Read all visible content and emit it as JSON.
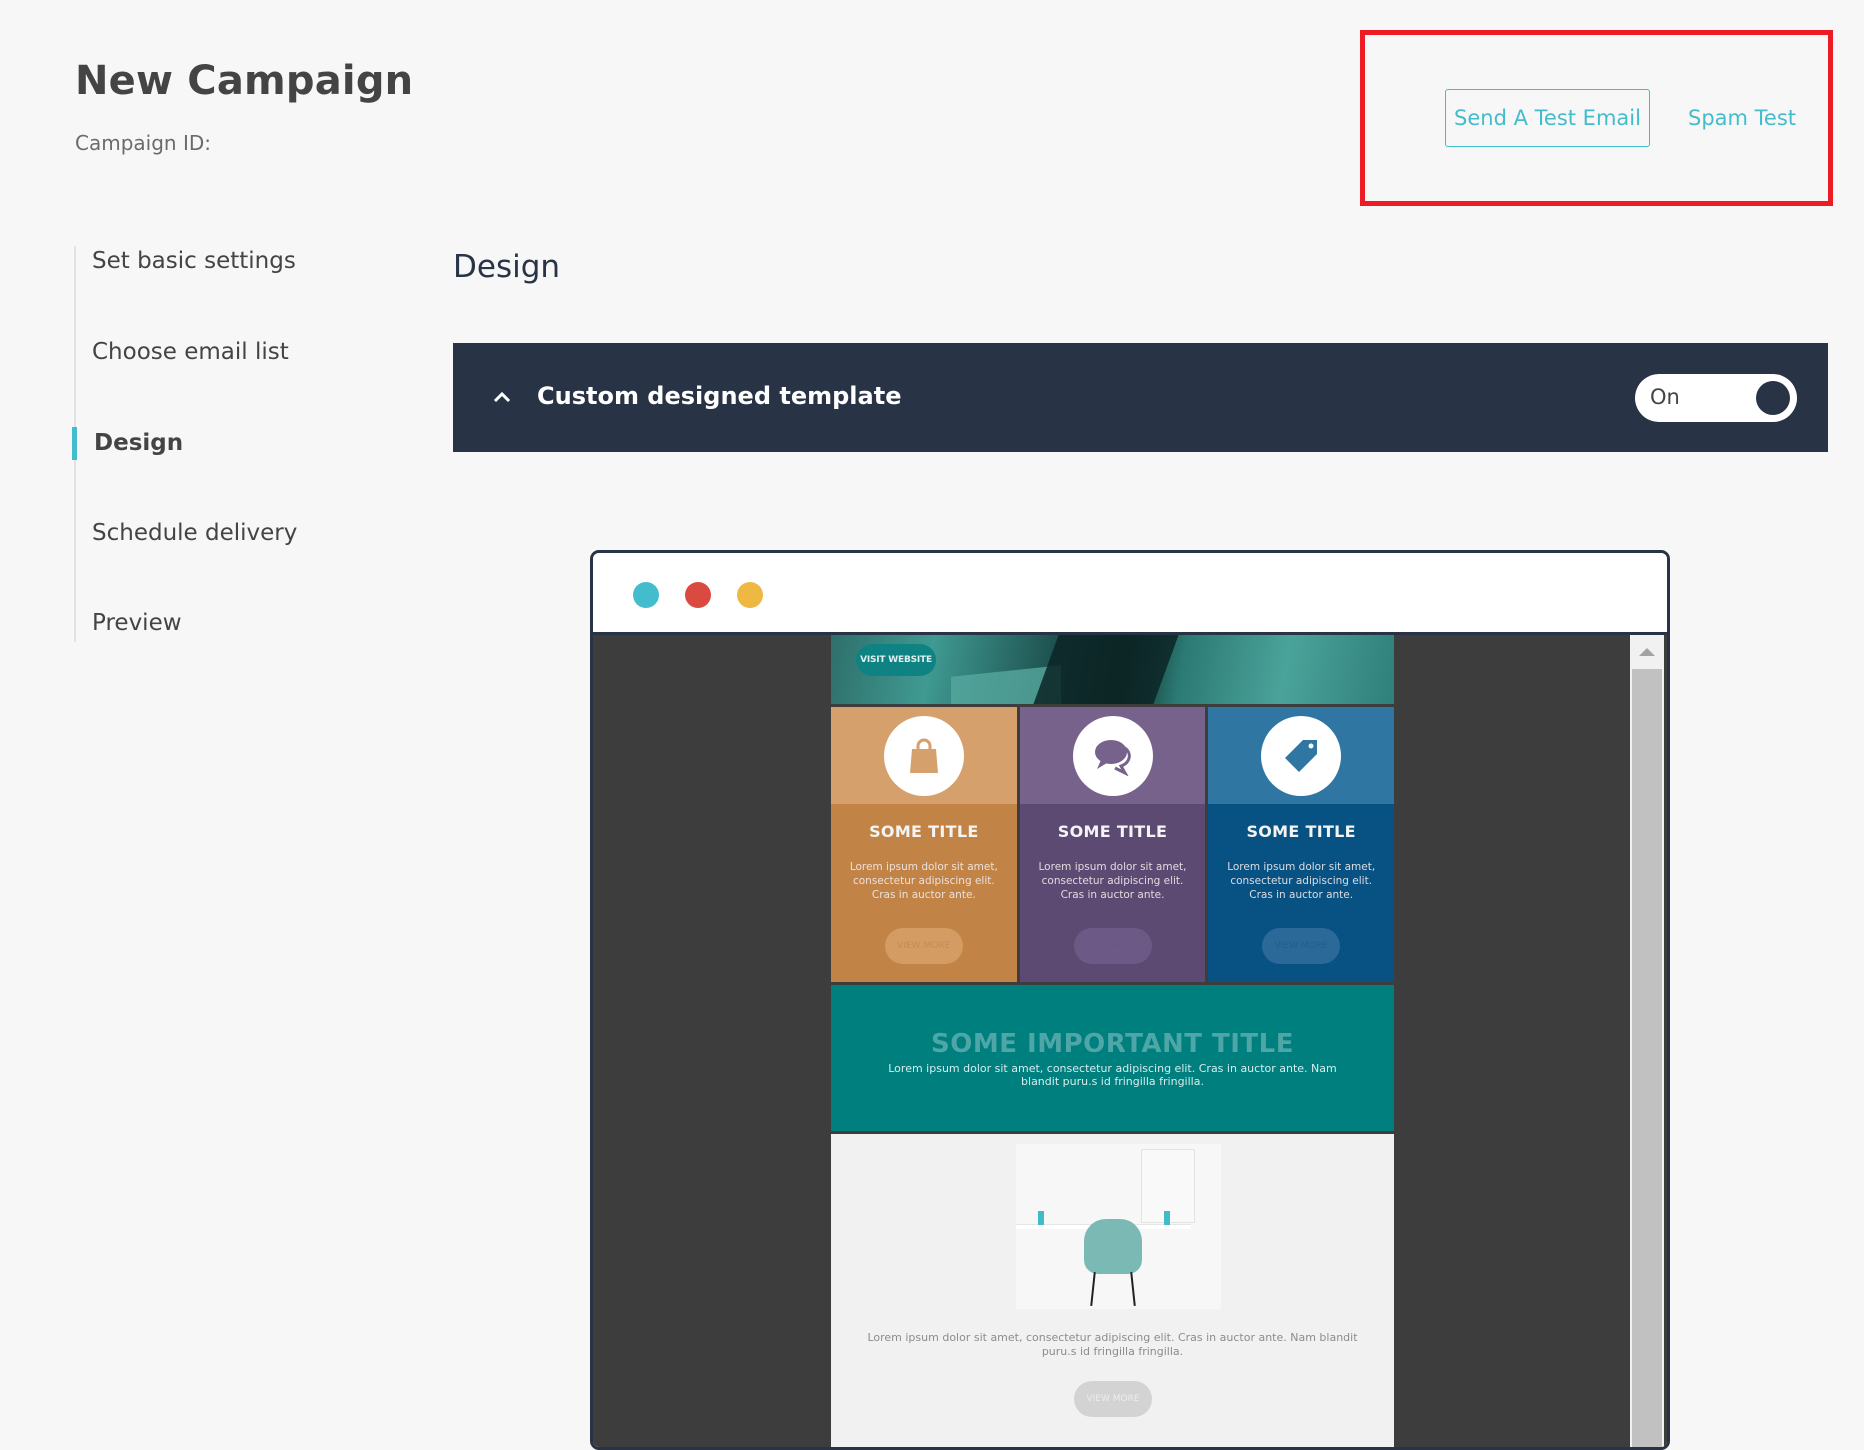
{
  "header": {
    "title": "New Campaign",
    "campaign_id_label": "Campaign ID:"
  },
  "actions": {
    "send_test_email": "Send A Test Email",
    "spam_test": "Spam Test"
  },
  "steps": [
    {
      "label": "Set basic settings",
      "active": false
    },
    {
      "label": "Choose email list",
      "active": false
    },
    {
      "label": "Design",
      "active": true
    },
    {
      "label": "Schedule delivery",
      "active": false
    },
    {
      "label": "Preview",
      "active": false
    }
  ],
  "main": {
    "section_title": "Design",
    "template_panel": {
      "label": "Custom designed template",
      "toggle_label": "On",
      "toggle_state": true,
      "chevron_icon": "chevron-up-icon"
    }
  },
  "preview": {
    "window_dots": [
      {
        "name": "teal",
        "color": "#43bccd"
      },
      {
        "name": "red",
        "color": "#da4a40"
      },
      {
        "name": "yellow",
        "color": "#eeb843"
      }
    ],
    "email": {
      "hero_button": "VISIT WEBSITE",
      "cards": [
        {
          "icon": "shopping-bag-icon",
          "title": "SOME TITLE",
          "text": "Lorem ipsum dolor sit amet, consectetur adipiscing elit. Cras in auctor ante.",
          "button": "VIEW MORE",
          "top_color": "#d5a06c",
          "bottom_color": "#c28446",
          "btn_color": "#d49c63",
          "btn_text_color": "#c58a52"
        },
        {
          "icon": "chat-bubbles-icon",
          "title": "SOME TITLE",
          "text": "Lorem ipsum dolor sit amet, consectetur adipiscing elit. Cras in auctor ante.",
          "button": "VIEW MORE",
          "top_color": "#77628b",
          "bottom_color": "#5c4a73",
          "btn_color": "#6d5985",
          "btn_text_color": "#6b5883"
        },
        {
          "icon": "price-tag-icon",
          "title": "SOME TITLE",
          "text": "Lorem ipsum dolor sit amet, consectetur adipiscing elit. Cras in auctor ante.",
          "button": "VIEW MORE",
          "top_color": "#2f76a3",
          "bottom_color": "#075283",
          "btn_color": "#2b6a98",
          "btn_text_color": "#1f5f8e"
        }
      ],
      "important": {
        "title": "SOME IMPORTANT TITLE",
        "text": "Lorem ipsum dolor sit amet, consectetur adipiscing elit. Cras in auctor ante. Nam blandit puru.s id fringilla fringilla."
      },
      "feature": {
        "text": "Lorem ipsum dolor sit amet, consectetur adipiscing elit. Cras in auctor ante. Nam blandit puru.s id fringilla fringilla.",
        "button": "VIEW MORE"
      }
    }
  },
  "colors": {
    "accent": "#43bccd",
    "dark_navy": "#293346",
    "highlight_red": "#ed1c24",
    "page_bg": "#f7f7f7"
  }
}
